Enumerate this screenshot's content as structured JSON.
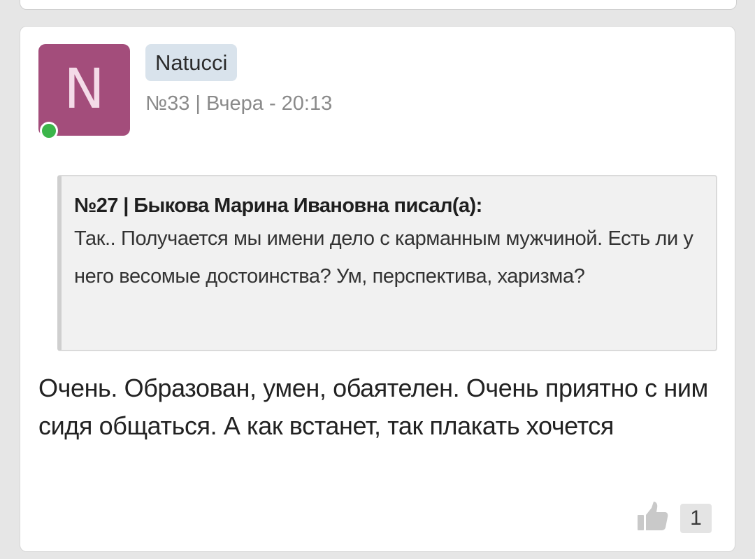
{
  "post": {
    "avatar_letter": "N",
    "avatar_color": "#a34d7b",
    "online_status_color": "#3bb54a",
    "username": "Natucci",
    "meta": "№33 | Вчера - 20:13",
    "quote": {
      "header": "№27 | Быкова Марина Ивановна писал(а):",
      "text": "Так.. Получается мы имени дело с карманным мужчиной. Есть ли у него весомые достоинства? Ум, перспектива, харизма?"
    },
    "text": "Очень. Образован, умен, обаятелен. Очень приятно с ним сидя общаться. А как встанет, так плакать хочется",
    "like_icon": "thumbs-up-icon",
    "like_count": "1"
  }
}
